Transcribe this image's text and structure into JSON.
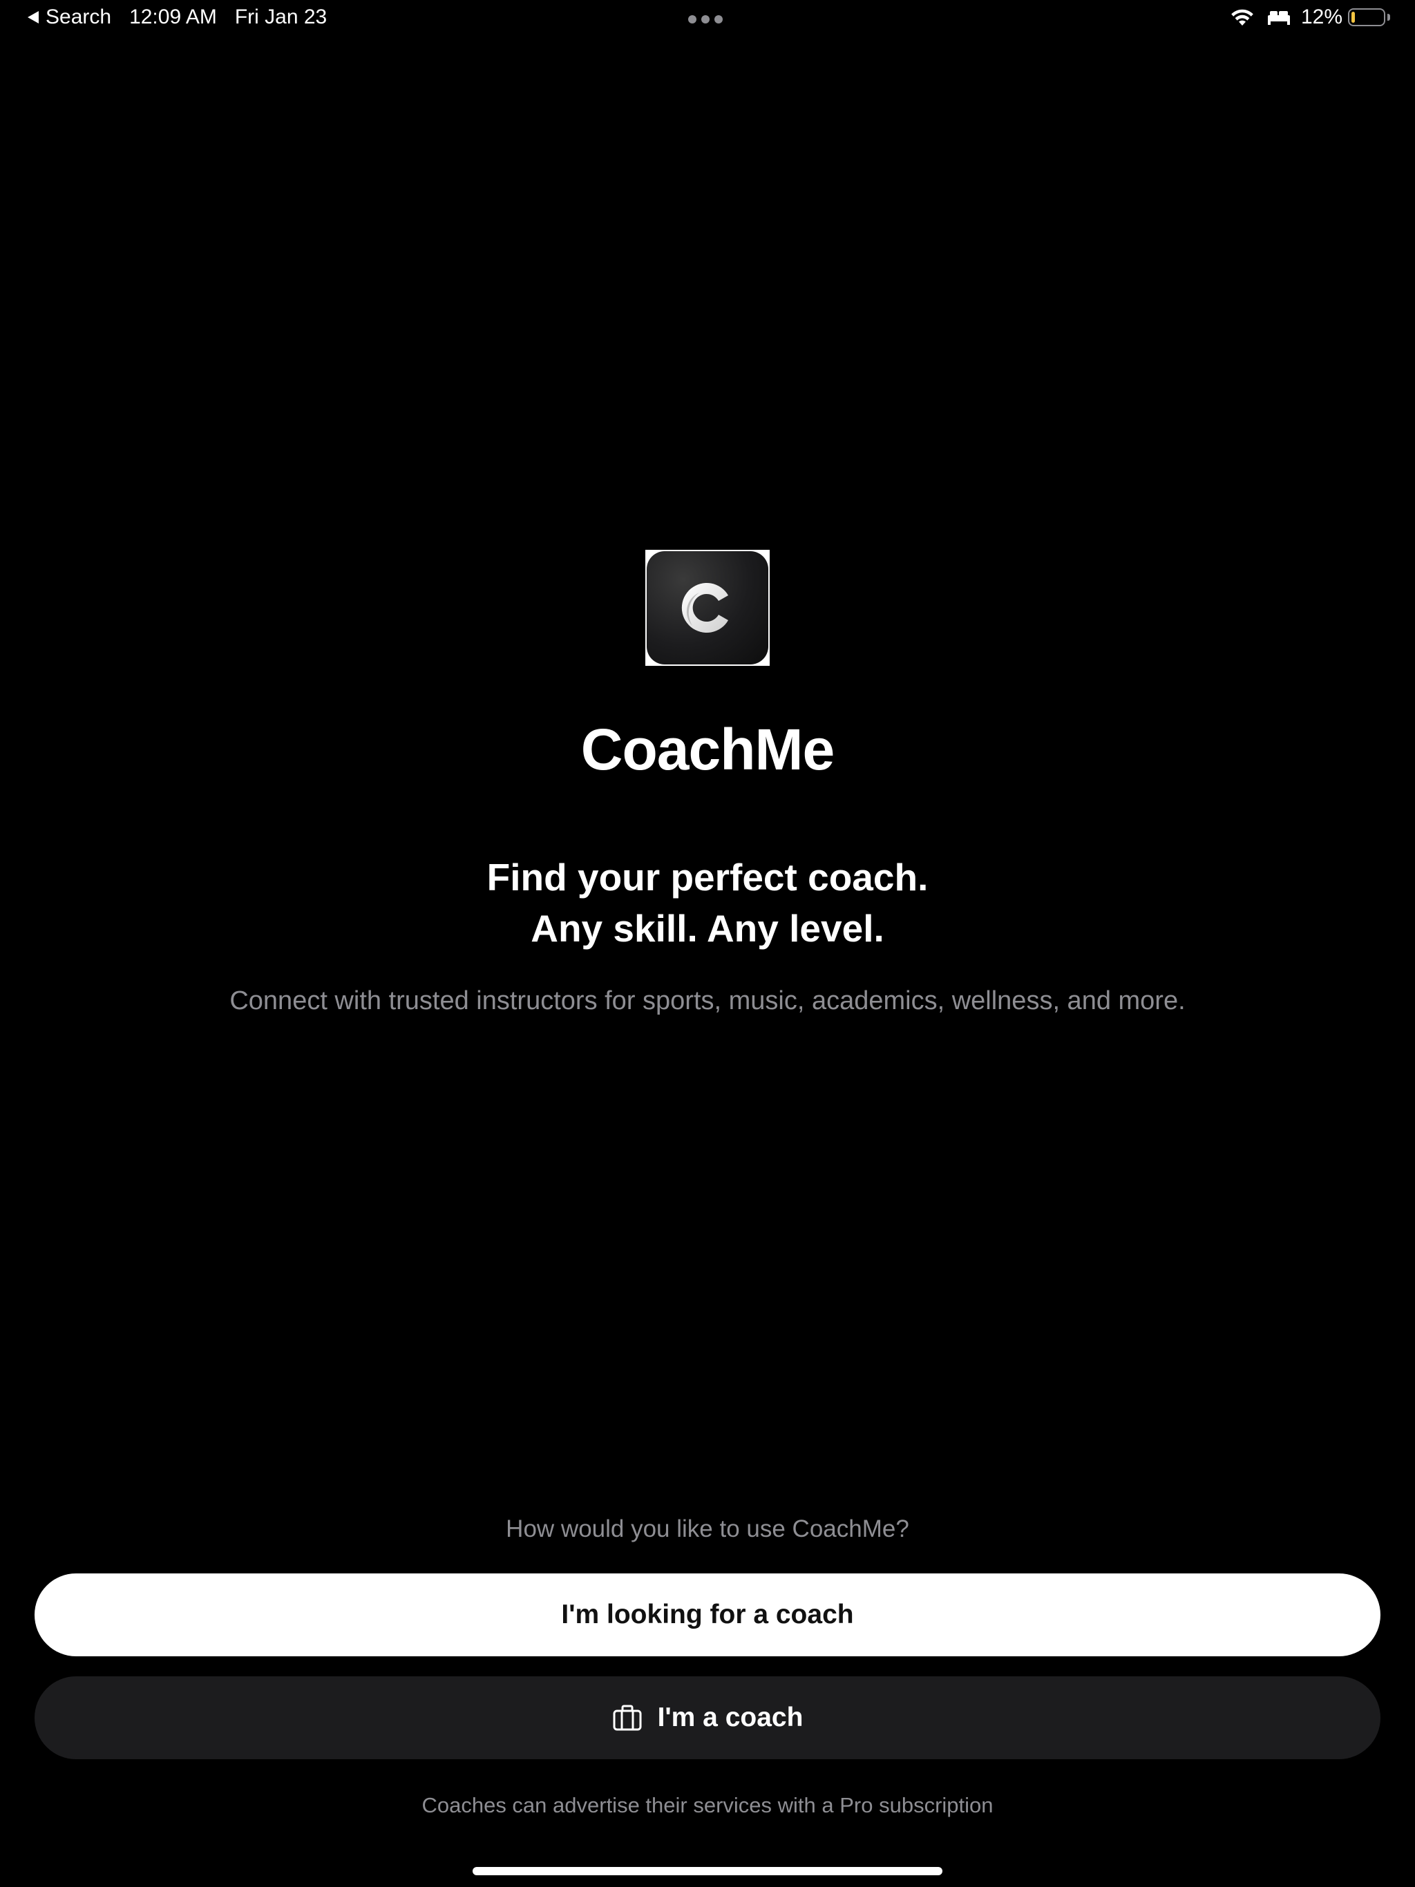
{
  "status_bar": {
    "back_label": "Search",
    "time": "12:09 AM",
    "date": "Fri Jan 23",
    "battery_percent_label": "12%",
    "battery_level": 0.12,
    "battery_fill_color": "#f4c542",
    "icons": [
      "back-arrow-icon",
      "multitask-dots-icon",
      "wifi-icon",
      "sleep-bed-icon",
      "battery-icon"
    ]
  },
  "hero": {
    "logo_icon": "coachme-c-logo-icon",
    "app_name": "CoachMe",
    "headline_line1": "Find your perfect coach.",
    "headline_line2": "Any skill. Any level.",
    "subtitle": "Connect with trusted instructors for sports, music, academics, wellness, and more."
  },
  "onboarding": {
    "question": "How would you like to use CoachMe?",
    "primary_button_label": "I'm looking for a coach",
    "secondary_button_label": "I'm a coach",
    "secondary_button_icon": "briefcase-icon",
    "footnote": "Coaches can advertise their services with a Pro subscription"
  },
  "colors": {
    "background": "#000000",
    "primary_button_bg": "#ffffff",
    "primary_button_text": "#111111",
    "secondary_button_bg": "#1c1c1e",
    "muted_text": "#8e8e93"
  }
}
